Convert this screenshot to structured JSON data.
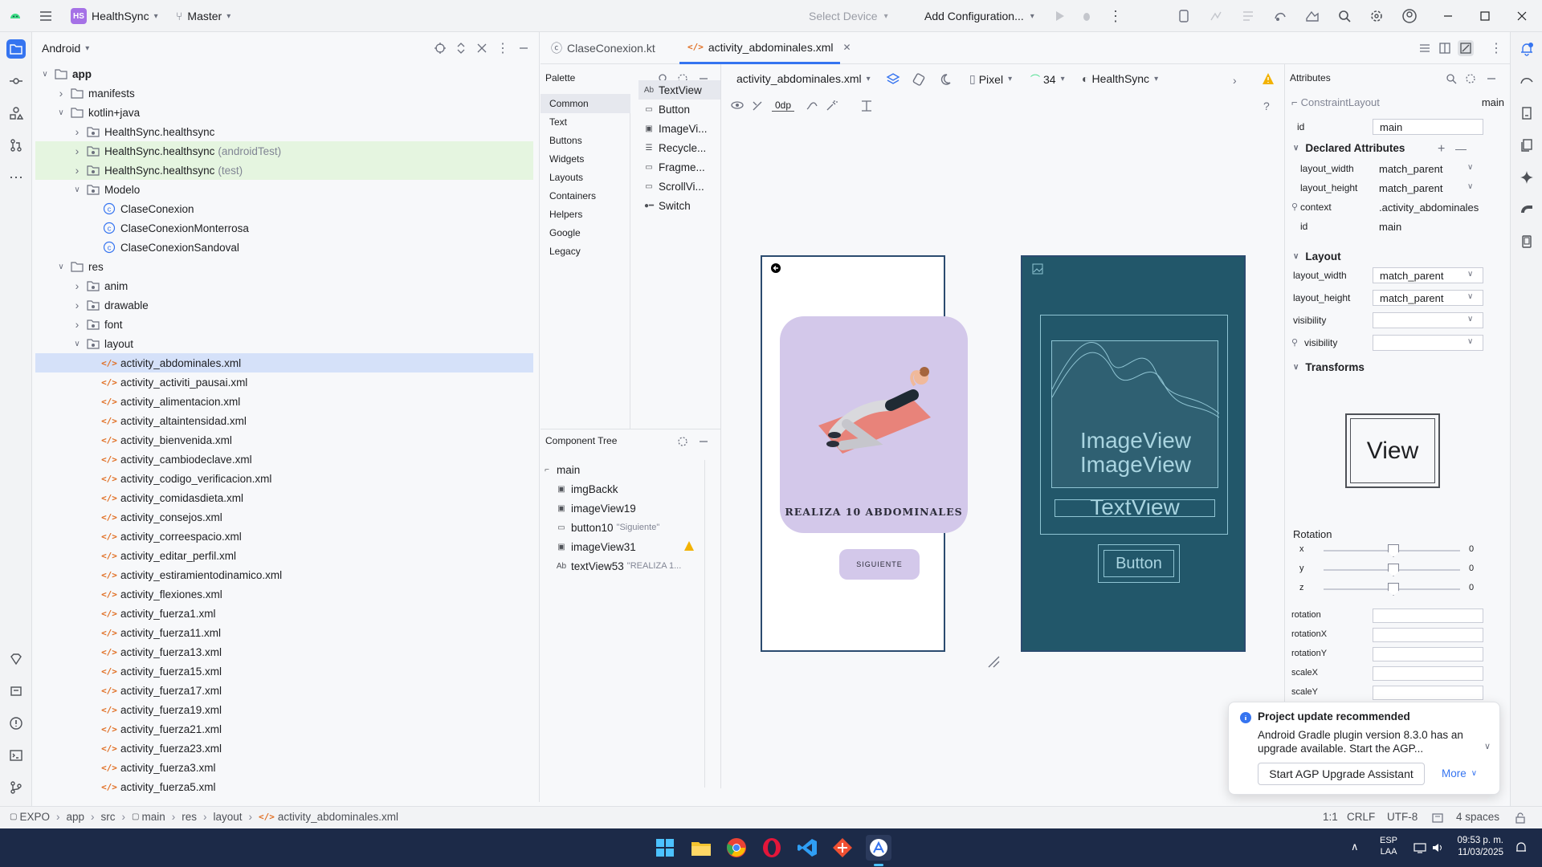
{
  "titlebar": {
    "project_badge": "HS",
    "project_name": "HealthSync",
    "branch": "Master",
    "select_device": "Select Device",
    "add_config": "Add Configuration..."
  },
  "project_panel": {
    "view_mode": "Android",
    "tree": [
      {
        "label": "app",
        "arrow": "v",
        "icon": "folder"
      },
      {
        "label": "manifests",
        "arrow": ">",
        "icon": "folder"
      },
      {
        "label": "kotlin+java",
        "arrow": "v",
        "icon": "folder"
      },
      {
        "label": "HealthSync.healthsync",
        "suffix": "",
        "arrow": ">",
        "icon": "package"
      },
      {
        "label": "HealthSync.healthsync",
        "suffix": "(androidTest)",
        "arrow": ">",
        "icon": "package"
      },
      {
        "label": "HealthSync.healthsync",
        "suffix": "(test)",
        "arrow": ">",
        "icon": "package"
      },
      {
        "label": "Modelo",
        "arrow": "v",
        "icon": "package"
      },
      {
        "label": "ClaseConexion",
        "icon": "class"
      },
      {
        "label": "ClaseConexionMonterrosa",
        "icon": "class"
      },
      {
        "label": "ClaseConexionSandoval",
        "icon": "class"
      },
      {
        "label": "res",
        "arrow": "v",
        "icon": "folder"
      },
      {
        "label": "anim",
        "arrow": ">",
        "icon": "package"
      },
      {
        "label": "drawable",
        "arrow": ">",
        "icon": "package"
      },
      {
        "label": "font",
        "arrow": ">",
        "icon": "package"
      },
      {
        "label": "layout",
        "arrow": "v",
        "icon": "package"
      },
      {
        "label": "activity_abdominales.xml",
        "icon": "xml"
      },
      {
        "label": "activity_activiti_pausai.xml",
        "icon": "xml"
      },
      {
        "label": "activity_alimentacion.xml",
        "icon": "xml"
      },
      {
        "label": "activity_altaintensidad.xml",
        "icon": "xml"
      },
      {
        "label": "activity_bienvenida.xml",
        "icon": "xml"
      },
      {
        "label": "activity_cambiodeclave.xml",
        "icon": "xml"
      },
      {
        "label": "activity_codigo_verificacion.xml",
        "icon": "xml"
      },
      {
        "label": "activity_comidasdieta.xml",
        "icon": "xml"
      },
      {
        "label": "activity_consejos.xml",
        "icon": "xml"
      },
      {
        "label": "activity_correespacio.xml",
        "icon": "xml"
      },
      {
        "label": "activity_editar_perfil.xml",
        "icon": "xml"
      },
      {
        "label": "activity_estiramientodinamico.xml",
        "icon": "xml"
      },
      {
        "label": "activity_flexiones.xml",
        "icon": "xml"
      },
      {
        "label": "activity_fuerza1.xml",
        "icon": "xml"
      },
      {
        "label": "activity_fuerza11.xml",
        "icon": "xml"
      },
      {
        "label": "activity_fuerza13.xml",
        "icon": "xml"
      },
      {
        "label": "activity_fuerza15.xml",
        "icon": "xml"
      },
      {
        "label": "activity_fuerza17.xml",
        "icon": "xml"
      },
      {
        "label": "activity_fuerza19.xml",
        "icon": "xml"
      },
      {
        "label": "activity_fuerza21.xml",
        "icon": "xml"
      },
      {
        "label": "activity_fuerza23.xml",
        "icon": "xml"
      },
      {
        "label": "activity_fuerza3.xml",
        "icon": "xml"
      },
      {
        "label": "activity_fuerza5.xml",
        "icon": "xml"
      }
    ]
  },
  "editor": {
    "tabs": [
      {
        "label": "ClaseConexion.kt"
      },
      {
        "label": "activity_abdominales.xml"
      }
    ],
    "palette_title": "Palette",
    "palette_categories": [
      "Common",
      "Text",
      "Buttons",
      "Widgets",
      "Layouts",
      "Containers",
      "Helpers",
      "Google",
      "Legacy"
    ],
    "palette_widgets": [
      {
        "icon": "Ab",
        "label": "TextView"
      },
      {
        "icon": "btn",
        "label": "Button"
      },
      {
        "icon": "img",
        "label": "ImageVi..."
      },
      {
        "icon": "list",
        "label": "Recycle..."
      },
      {
        "icon": "frag",
        "label": "Fragme..."
      },
      {
        "icon": "scroll",
        "label": "ScrollVi..."
      },
      {
        "icon": "switch",
        "label": "Switch"
      }
    ],
    "component_tree_title": "Component Tree",
    "component_tree": [
      {
        "label": "main",
        "hint": "",
        "icon": "constraint"
      },
      {
        "label": "imgBackk",
        "hint": "",
        "icon": "img"
      },
      {
        "label": "imageView19",
        "hint": "",
        "icon": "img"
      },
      {
        "label": "button10",
        "hint": "\"Siguiente\"",
        "icon": "btn"
      },
      {
        "label": "imageView31",
        "hint": "",
        "icon": "img"
      },
      {
        "label": "textView53",
        "hint": "\"REALIZA 1...",
        "icon": "Ab"
      }
    ],
    "design_file": "activity_abdominales.xml",
    "device": "Pixel",
    "api": "34",
    "theme": "HealthSync",
    "margin": "0dp"
  },
  "preview": {
    "headline": "REALIZA 10 ABDOMINALES",
    "button": "SIGUIENTE",
    "blueprint_image1": "ImageView",
    "blueprint_image2": "ImageView",
    "blueprint_text": "TextView",
    "blueprint_button": "Button"
  },
  "attributes": {
    "title": "Attributes",
    "class": "ConstraintLayout",
    "class_id": "main",
    "id_label": "id",
    "id_value": "main",
    "declared_title": "Declared Attributes",
    "declared": [
      {
        "name": "layout_width",
        "value": "match_parent"
      },
      {
        "name": "layout_height",
        "value": "match_parent"
      },
      {
        "name": "context",
        "value": ".activity_abdominales"
      },
      {
        "name": "id",
        "value": "main"
      }
    ],
    "layout_title": "Layout",
    "layout": [
      {
        "name": "layout_width",
        "value": "match_parent"
      },
      {
        "name": "layout_height",
        "value": "match_parent"
      },
      {
        "name": "visibility",
        "value": ""
      },
      {
        "name": "visibility",
        "value": ""
      }
    ],
    "transforms_title": "Transforms",
    "view_label": "View",
    "rotation_title": "Rotation",
    "rot_axes": [
      {
        "axis": "x",
        "value": "0"
      },
      {
        "axis": "y",
        "value": "0"
      },
      {
        "axis": "z",
        "value": "0"
      }
    ],
    "props": [
      "rotation",
      "rotationX",
      "rotationY",
      "scaleX",
      "scaleY"
    ]
  },
  "notification": {
    "title": "Project update recommended",
    "body": "Android Gradle plugin version 8.3.0 has an upgrade available. Start the AGP...",
    "primary": "Start AGP Upgrade Assistant",
    "more": "More"
  },
  "statusbar": {
    "crumbs": [
      "EXPO",
      "app",
      "src",
      "main",
      "res",
      "layout",
      "activity_abdominales.xml"
    ],
    "position": "1:1",
    "line_sep": "CRLF",
    "encoding": "UTF-8",
    "indent": "4 spaces"
  },
  "taskbar": {
    "lang1": "ESP",
    "lang2": "LAA",
    "time": "09:53 p. m.",
    "date": "11/03/2025"
  }
}
